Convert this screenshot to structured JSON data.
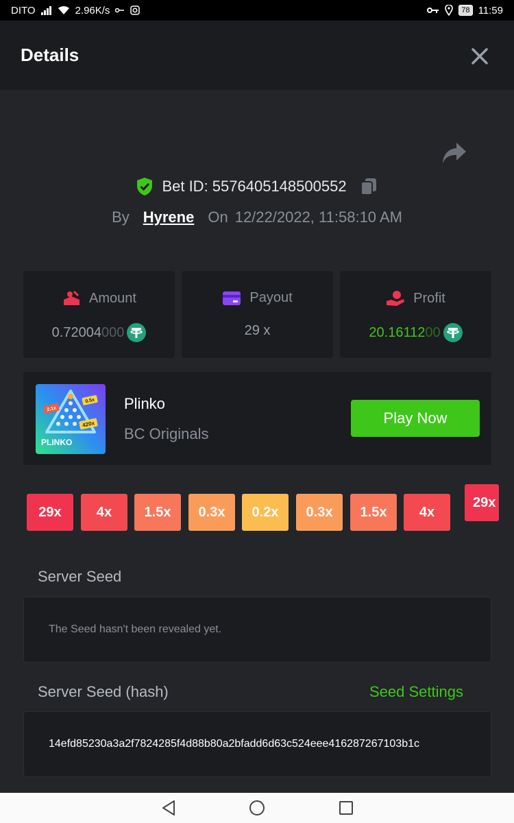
{
  "status_bar": {
    "carrier": "DITO",
    "speed": "2.96K/s",
    "battery": "78",
    "time": "11:59"
  },
  "header": {
    "title": "Details"
  },
  "bet": {
    "id_label": "Bet ID: 5576405148500552",
    "by_label": "By",
    "user": "Hyrene",
    "on_label": "On",
    "datetime": "12/22/2022, 11:58:10 AM"
  },
  "stats": {
    "amount": {
      "label": "Amount",
      "value_main": "0.72004",
      "value_dim": "000"
    },
    "payout": {
      "label": "Payout",
      "value": "29 x"
    },
    "profit": {
      "label": "Profit",
      "value_main": "20.16112",
      "value_dim": "00"
    }
  },
  "game": {
    "name": "Plinko",
    "provider": "BC Originals",
    "play_label": "Play Now",
    "thumb_title": "PLINKO",
    "thumb_badges": [
      "2.1x",
      "0.5x",
      "420x"
    ]
  },
  "multipliers": [
    {
      "label": "29x",
      "color": "#f0344f"
    },
    {
      "label": "4x",
      "color": "#f24a50"
    },
    {
      "label": "1.5x",
      "color": "#f7775a"
    },
    {
      "label": "0.3x",
      "color": "#f99c5a"
    },
    {
      "label": "0.2x",
      "color": "#fbbd4f"
    },
    {
      "label": "0.3x",
      "color": "#f99c5a"
    },
    {
      "label": "1.5x",
      "color": "#f7775a"
    },
    {
      "label": "4x",
      "color": "#f24a50"
    },
    {
      "label": "29x",
      "color": "#f0344f"
    }
  ],
  "server_seed": {
    "title": "Server Seed",
    "text": "The Seed hasn't been revealed yet."
  },
  "server_seed_hash": {
    "title": "Server Seed (hash)",
    "settings_label": "Seed Settings",
    "hash": "14efd85230a3a2f7824285f4d88b80a2bfadd6d63c524eee416287267103b1c"
  },
  "colors": {
    "accent": "#3fc61b",
    "background": "#232528",
    "panel": "#1b1c1f"
  }
}
